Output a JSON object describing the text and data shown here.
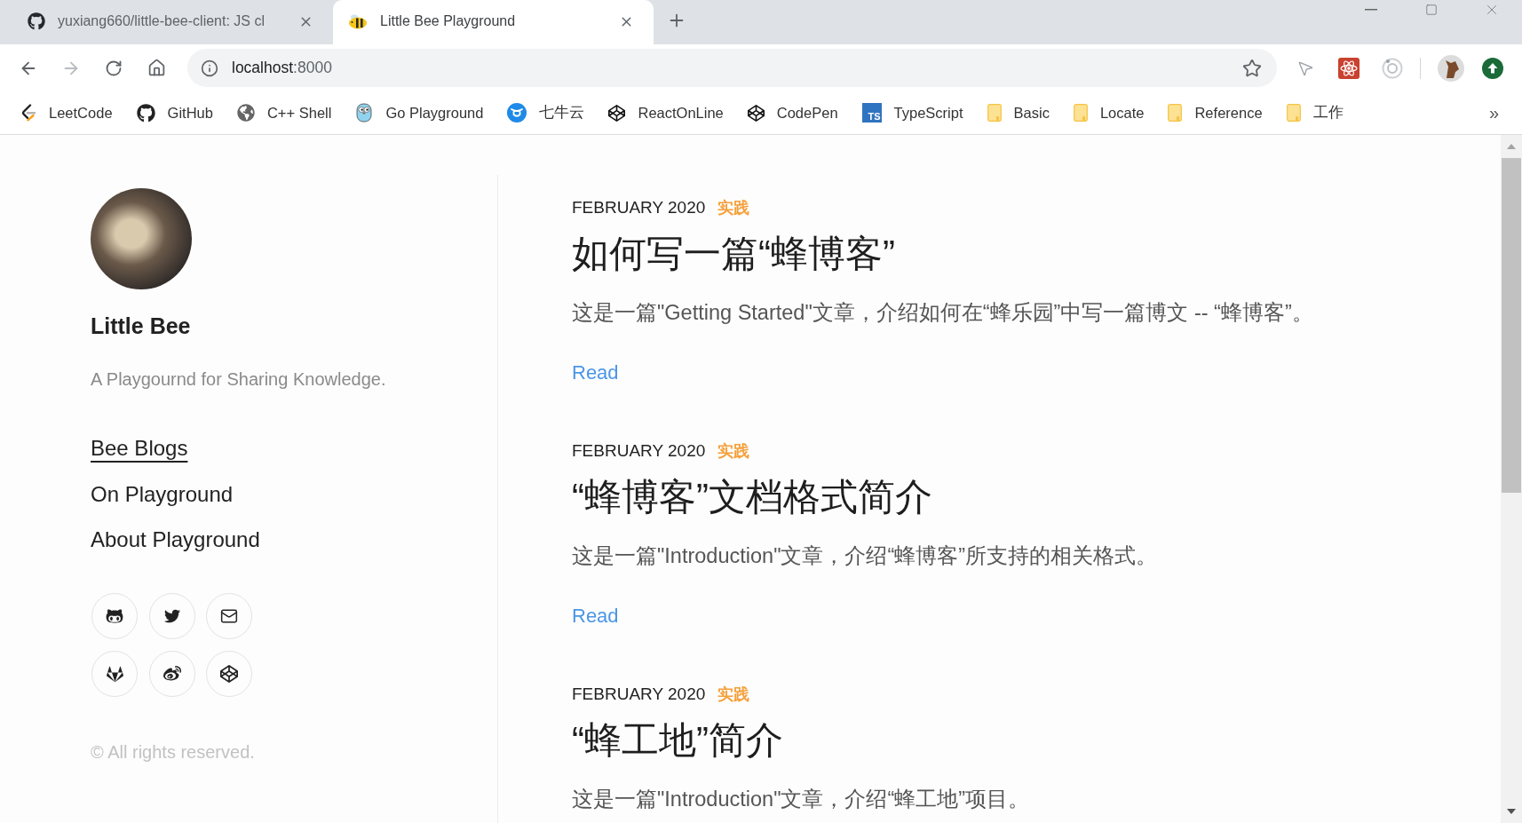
{
  "browser": {
    "tabs": [
      {
        "title": "yuxiang660/little-bee-client: JS cl",
        "kind": "github",
        "selected": false
      },
      {
        "title": "Little Bee Playground",
        "kind": "bee",
        "selected": true
      }
    ],
    "toolbar": {
      "forward_disabled": true
    },
    "address": {
      "host": "localhost",
      "port": ":8000"
    },
    "bookmarks": [
      {
        "label": "LeetCode",
        "kind": "leetcode"
      },
      {
        "label": "GitHub",
        "kind": "github"
      },
      {
        "label": "C++ Shell",
        "kind": "globe"
      },
      {
        "label": "Go Playground",
        "kind": "gopher"
      },
      {
        "label": "七牛云",
        "kind": "qiniu"
      },
      {
        "label": "ReactOnLine",
        "kind": "codepen"
      },
      {
        "label": "CodePen",
        "kind": "codepen"
      },
      {
        "label": "TypeScript",
        "kind": "ts",
        "badge": "TS"
      },
      {
        "label": "Basic",
        "kind": "folder"
      },
      {
        "label": "Locate",
        "kind": "folder"
      },
      {
        "label": "Reference",
        "kind": "folder"
      },
      {
        "label": "工作",
        "kind": "folder"
      }
    ],
    "bookmarks_overflow": "»"
  },
  "sidebar": {
    "name": "Little Bee",
    "tagline": "A Playgournd for Sharing Knowledge.",
    "nav": [
      {
        "label": "Bee Blogs",
        "selected": true
      },
      {
        "label": "On Playground",
        "selected": false
      },
      {
        "label": "About Playground",
        "selected": false
      }
    ],
    "copyright": "© All rights reserved."
  },
  "posts": [
    {
      "date": "FEBRUARY 2020",
      "category": "实践",
      "title": "如何写一篇“蜂博客”",
      "summary": "这是一篇\"Getting Started\"文章，介绍如何在“蜂乐园”中写一篇博文 -- “蜂博客”。",
      "link": "Read"
    },
    {
      "date": "FEBRUARY 2020",
      "category": "实践",
      "title": "“蜂博客”文档格式简介",
      "summary": "这是一篇\"Introduction\"文章，介绍“蜂博客”所支持的相关格式。",
      "link": "Read"
    },
    {
      "date": "FEBRUARY 2020",
      "category": "实践",
      "title": "“蜂工地”简介",
      "summary": "这是一篇\"Introduction\"文章，介绍“蜂工地”项目。"
    }
  ]
}
